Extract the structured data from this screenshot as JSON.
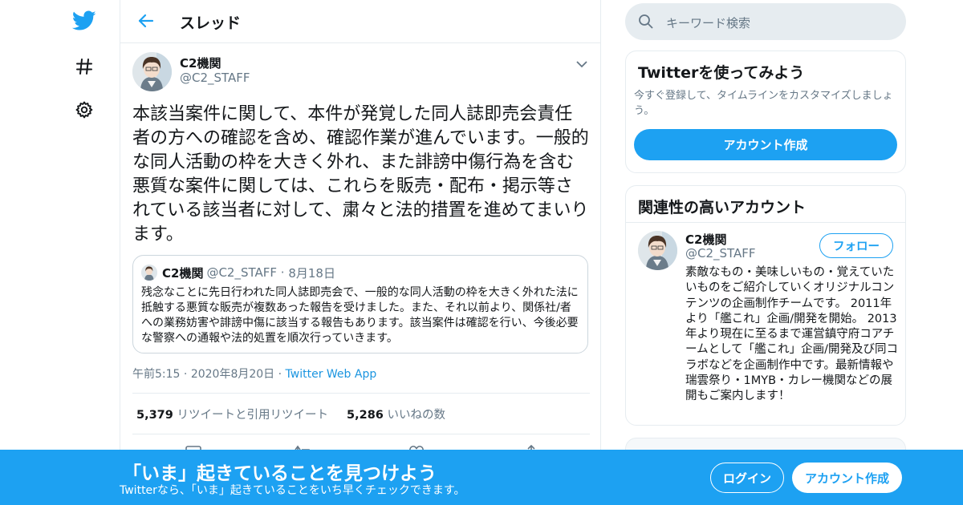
{
  "header": {
    "title": "スレッド"
  },
  "tweet": {
    "author_name": "C2機関",
    "author_handle": "@C2_STAFF",
    "text": "本該当案件に関して、本件が発覚した同人誌即売会責任者の方への確認を含め、確認作業が進んでいます。一般的な同人活動の枠を大きく外れ、また誹謗中傷行為を含む悪質な案件に関しては、これらを販売・配布・掲示等されている該当者に対して、粛々と法的措置を進めてまいります。",
    "time": "午前5:15",
    "date": "2020年8月20日",
    "source": "Twitter Web App",
    "retweets": "5,379",
    "retweets_label": "リツイートと引用リツイート",
    "likes": "5,286",
    "likes_label": "いいねの数"
  },
  "quote": {
    "name": "C2機関",
    "handle": "@C2_STAFF",
    "date": "8月18日",
    "text": "残念なことに先日行われた同人誌即売会で、一般的な同人活動の枠を大きく外れた法に抵触する悪質な販売が複数あった報告を受けました。また、それ以前より、関係社/者への業務妨害や誹謗中傷に該当する報告もあります。該当案件は確認を行い、今後必要な警察への通報や法的処置を順次行っていきます。"
  },
  "search": {
    "placeholder": "キーワード検索"
  },
  "try_card": {
    "title": "Twitterを使ってみよう",
    "desc": "今すぐ登録して、タイムラインをカスタマイズしましょう。",
    "button": "アカウント作成"
  },
  "related": {
    "title": "関連性の高いアカウント",
    "name": "C2機関",
    "handle": "@C2_STAFF",
    "follow": "フォロー",
    "bio": "素敵なもの・美味しいもの・覚えていたいものをご紹介していくオリジナルコンテンツの企画制作チームです。 2011年より「艦これ」企画/開発を開始。 2013年より現在に至るまで運営鎮守府コアチームとして「艦これ」企画/開発及び同コラボなどを企画制作中です。最新情報や瑞雲祭り・1MYB・カレー機関などの展開もご案内します！"
  },
  "bottom_bar": {
    "title": "「いま」起きていることを見つけよう",
    "subtitle": "Twitterなら、「いま」起きていることをいち早くチェックできます。",
    "login": "ログイン",
    "signup": "アカウント作成"
  },
  "colors": {
    "brand": "#1da1f2",
    "muted": "#657786",
    "border": "#e6ecf0"
  },
  "icons": [
    "twitter-bird-icon",
    "hashtag-icon",
    "gear-icon",
    "back-arrow-icon",
    "chevron-down-icon",
    "search-icon",
    "reply-icon",
    "retweet-icon",
    "like-icon",
    "share-icon"
  ]
}
